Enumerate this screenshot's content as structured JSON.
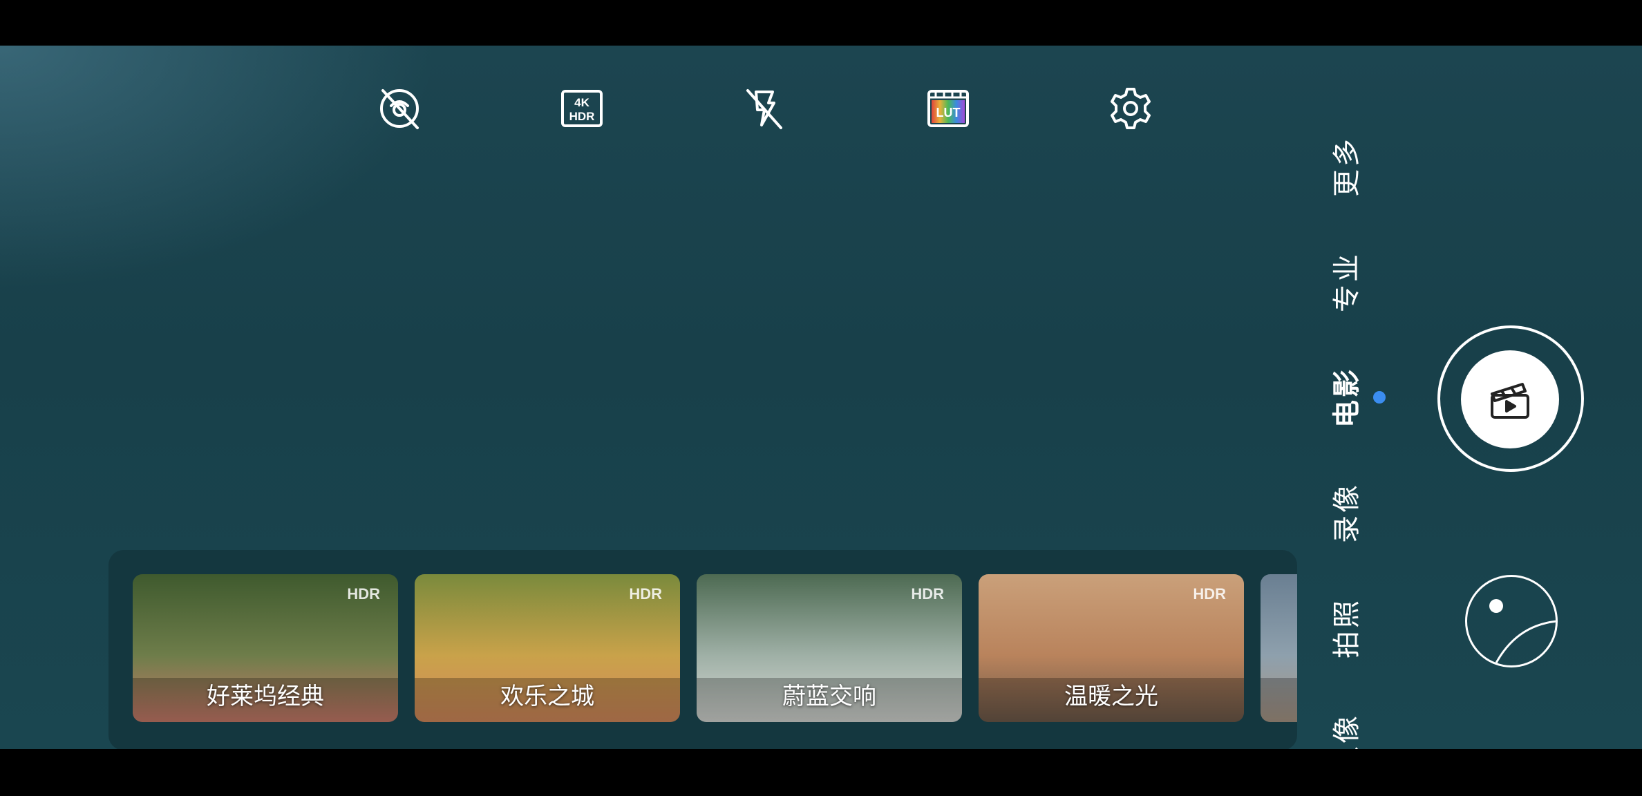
{
  "top_toolbar": [
    {
      "icon": "ai-lens-off-icon"
    },
    {
      "icon": "4k-hdr-icon",
      "text": [
        "4K",
        "HDR"
      ]
    },
    {
      "icon": "flash-off-icon"
    },
    {
      "icon": "lut-icon",
      "text": "LUT"
    },
    {
      "icon": "settings-gear-icon"
    }
  ],
  "modes": [
    {
      "label": "更多"
    },
    {
      "label": "专业"
    },
    {
      "label": "电影",
      "active": true
    },
    {
      "label": "录像"
    },
    {
      "label": "拍照"
    },
    {
      "label": "人像"
    }
  ],
  "filters": [
    {
      "name": "好莱坞经典",
      "badge": "HDR",
      "colors": [
        "#3f5a2e",
        "#6e7d4a",
        "#c97b6a"
      ]
    },
    {
      "name": "欢乐之城",
      "badge": "HDR",
      "colors": [
        "#7a8a3c",
        "#c9a24a",
        "#d48a5c"
      ]
    },
    {
      "name": "蔚蓝交响",
      "badge": "HDR",
      "colors": [
        "#4d6a52",
        "#9fb0a6",
        "#d6d8d4"
      ]
    },
    {
      "name": "温暖之光",
      "badge": "HDR",
      "colors": [
        "#caa07a",
        "#b9835c",
        "#6e5a4a"
      ]
    },
    {
      "name": "",
      "badge": "",
      "colors": [
        "#6a7f92",
        "#8ea0ad",
        "#a99786"
      ]
    }
  ],
  "colors": {
    "accent_dot": "#3b8df0",
    "viewfinder": "#1a434d"
  }
}
